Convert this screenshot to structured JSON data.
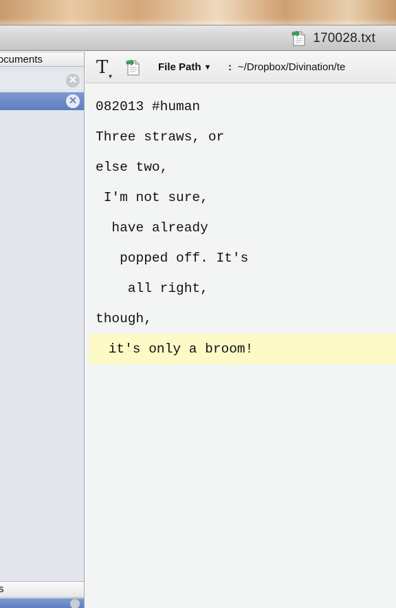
{
  "window": {
    "title": "170028.txt",
    "title_icon": "text-document-icon"
  },
  "sidebar": {
    "header": "Documents",
    "rows": [
      {
        "selected": false,
        "close_icon": "close-circle-icon"
      },
      {
        "selected": true,
        "close_icon": "close-circle-icon"
      }
    ],
    "footer": "s"
  },
  "toolbar": {
    "font_icon": "T",
    "file_path_label": "File Path",
    "file_path_separator": ":",
    "file_path_value": "~/Dropbox/Divination/te"
  },
  "editor": {
    "lines": [
      "082013 #human",
      "Three straws, or",
      "else two,",
      " I'm not sure,",
      "  have already",
      "   popped off. It's",
      "    all right,",
      "though,",
      " it's only a broom!"
    ],
    "current_line_index": 8
  },
  "colors": {
    "current_line_highlight": "#fdfac7",
    "selection": "#6585c4",
    "editor_background": "#f3f4f4"
  }
}
